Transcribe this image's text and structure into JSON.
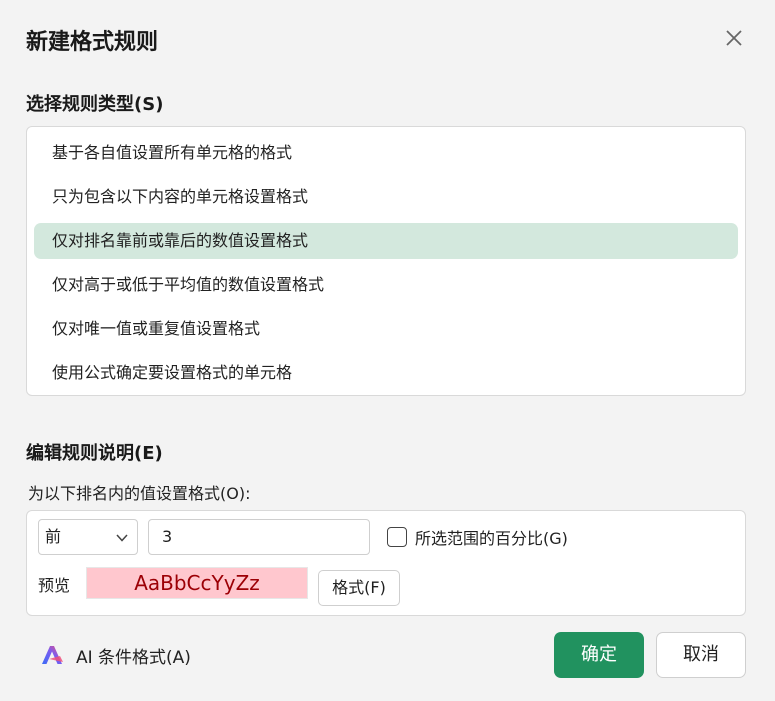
{
  "dialog": {
    "title": "新建格式规则",
    "close_icon": "close-icon"
  },
  "rule_type": {
    "label": "选择规则类型(S)",
    "selected_index": 2,
    "items": [
      {
        "label": "基于各自值设置所有单元格的格式"
      },
      {
        "label": "只为包含以下内容的单元格设置格式"
      },
      {
        "label": "仅对排名靠前或靠后的数值设置格式"
      },
      {
        "label": "仅对高于或低于平均值的数值设置格式"
      },
      {
        "label": "仅对唯一值或重复值设置格式"
      },
      {
        "label": "使用公式确定要设置格式的单元格"
      }
    ]
  },
  "edit": {
    "label": "编辑规则说明(E)",
    "sub_label": "为以下排名内的值设置格式(O):",
    "rank_select": {
      "value": "前",
      "icon": "chevron-down-icon"
    },
    "rank_value": "3",
    "percent_checkbox": {
      "label": "所选范围的百分比(G)",
      "checked": false
    },
    "preview_label": "预览",
    "preview_text": "AaBbCcYyZz",
    "format_button": "格式(F)"
  },
  "footer": {
    "ai_icon": "ai-logo-icon",
    "ai_label": "AI 条件格式(A)",
    "ok_label": "确定",
    "cancel_label": "取消"
  },
  "colors": {
    "selected_row": "#d3e8dd",
    "primary_button": "#21925f",
    "preview_fill": "#ffc7ce",
    "preview_text": "#9c0006"
  }
}
